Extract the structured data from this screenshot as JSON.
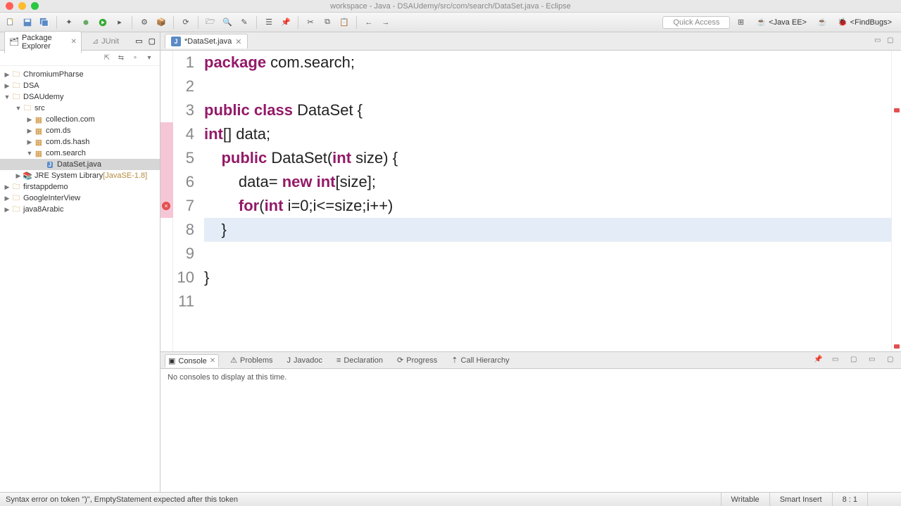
{
  "window": {
    "title": "workspace - Java - DSAUdemy/src/com/search/DataSet.java - Eclipse"
  },
  "toolbar": {
    "quick_access": "Quick Access",
    "perspectives": [
      {
        "label": "<Java EE>",
        "active": false
      },
      {
        "label": "<FindBugs>",
        "active": false
      }
    ]
  },
  "sidebar": {
    "tabs": [
      {
        "label": "Package Explorer",
        "active": true
      },
      {
        "label": "JUnit",
        "active": false
      }
    ],
    "tree": [
      {
        "label": "ChromiumPharse",
        "depth": 0,
        "icon": "project",
        "expand": "closed"
      },
      {
        "label": "DSA",
        "depth": 0,
        "icon": "project",
        "expand": "closed"
      },
      {
        "label": "DSAUdemy",
        "depth": 0,
        "icon": "project",
        "expand": "open"
      },
      {
        "label": "src",
        "depth": 1,
        "icon": "folder",
        "expand": "open"
      },
      {
        "label": "collection.com",
        "depth": 2,
        "icon": "package",
        "expand": "closed"
      },
      {
        "label": "com.ds",
        "depth": 2,
        "icon": "package",
        "expand": "closed"
      },
      {
        "label": "com.ds.hash",
        "depth": 2,
        "icon": "package",
        "expand": "closed"
      },
      {
        "label": "com.search",
        "depth": 2,
        "icon": "package",
        "expand": "open"
      },
      {
        "label": "DataSet.java",
        "depth": 3,
        "icon": "java",
        "expand": "none",
        "selected": true
      },
      {
        "label": "JRE System Library",
        "suffix": "[JavaSE-1.8]",
        "depth": 1,
        "icon": "jre",
        "expand": "closed"
      },
      {
        "label": "firstappdemo",
        "depth": 0,
        "icon": "project",
        "expand": "closed"
      },
      {
        "label": "GoogleInterView",
        "depth": 0,
        "icon": "project",
        "expand": "closed"
      },
      {
        "label": "java8Arabic",
        "depth": 0,
        "icon": "project",
        "expand": "closed"
      }
    ]
  },
  "editor": {
    "tab_label": "*DataSet.java",
    "lines": [
      {
        "n": 1,
        "segments": [
          {
            "t": "package ",
            "c": "kw"
          },
          {
            "t": "com.search;",
            "c": "ident"
          }
        ]
      },
      {
        "n": 2,
        "segments": [
          {
            "t": "",
            "c": "ident"
          }
        ]
      },
      {
        "n": 3,
        "segments": [
          {
            "t": "public class ",
            "c": "kw"
          },
          {
            "t": "DataSet {",
            "c": "ident"
          }
        ]
      },
      {
        "n": 4,
        "segments": [
          {
            "t": "int",
            "c": "kw"
          },
          {
            "t": "[] data;",
            "c": "ident"
          }
        ],
        "gutter_hl": true
      },
      {
        "n": 5,
        "segments": [
          {
            "t": "    ",
            "c": "ident"
          },
          {
            "t": "public ",
            "c": "kw"
          },
          {
            "t": "DataSet(",
            "c": "ident"
          },
          {
            "t": "int ",
            "c": "kw"
          },
          {
            "t": "size) {",
            "c": "ident"
          }
        ],
        "gutter_hl": true
      },
      {
        "n": 6,
        "segments": [
          {
            "t": "        data= ",
            "c": "ident"
          },
          {
            "t": "new int",
            "c": "kw"
          },
          {
            "t": "[size];",
            "c": "ident"
          }
        ],
        "gutter_hl": true
      },
      {
        "n": 7,
        "segments": [
          {
            "t": "        ",
            "c": "ident"
          },
          {
            "t": "for",
            "c": "kw"
          },
          {
            "t": "(",
            "c": "ident"
          },
          {
            "t": "int ",
            "c": "kw"
          },
          {
            "t": "i=0;i<=size;i++)",
            "c": "ident"
          }
        ],
        "gutter_hl": true,
        "error": true
      },
      {
        "n": 8,
        "segments": [
          {
            "t": "    }",
            "c": "ident"
          }
        ],
        "hl": true
      },
      {
        "n": 9,
        "segments": [
          {
            "t": "",
            "c": "ident"
          }
        ]
      },
      {
        "n": 10,
        "segments": [
          {
            "t": "}",
            "c": "ident"
          }
        ]
      },
      {
        "n": 11,
        "segments": [
          {
            "t": "",
            "c": "ident"
          }
        ]
      }
    ],
    "error_line": 7
  },
  "bottom": {
    "tabs": [
      {
        "label": "Console",
        "active": true
      },
      {
        "label": "Problems",
        "active": false
      },
      {
        "label": "Javadoc",
        "active": false
      },
      {
        "label": "Declaration",
        "active": false
      },
      {
        "label": "Progress",
        "active": false
      },
      {
        "label": "Call Hierarchy",
        "active": false
      }
    ],
    "message": "No consoles to display at this time."
  },
  "status": {
    "error_msg": "Syntax error on token \")\", EmptyStatement expected after this token",
    "writable": "Writable",
    "insert": "Smart Insert",
    "pos": "8 : 1"
  }
}
